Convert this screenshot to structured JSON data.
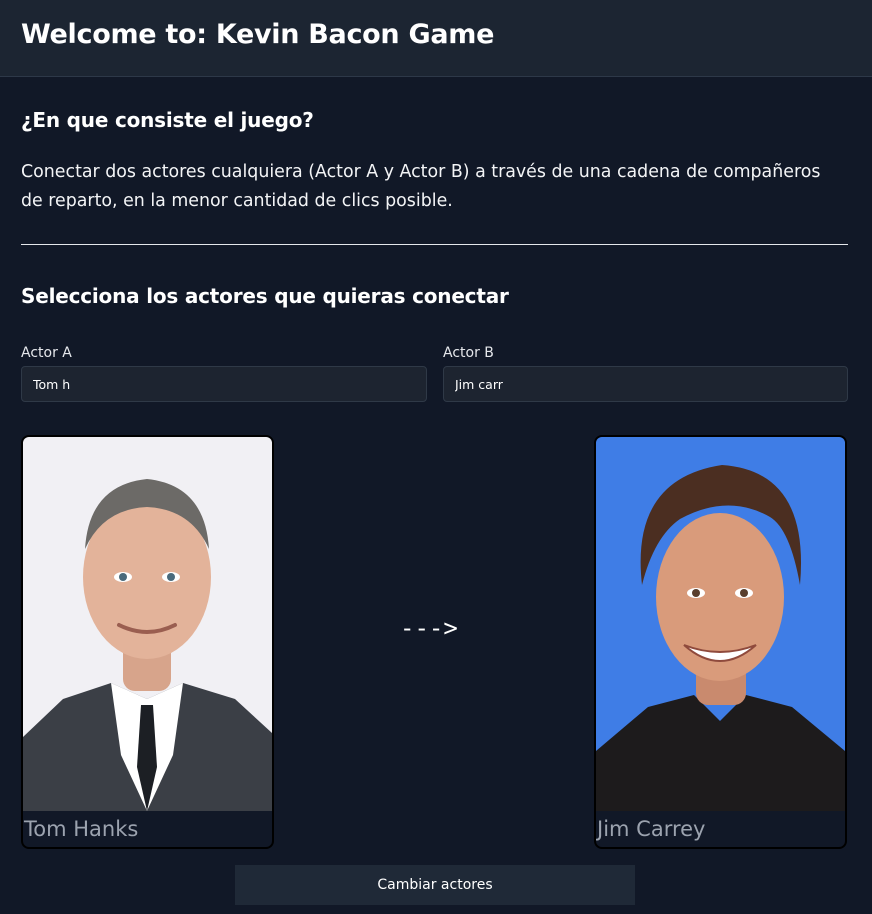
{
  "header": {
    "title": "Welcome to: Kevin Bacon Game"
  },
  "about": {
    "heading": "¿En que consiste el juego?",
    "description": "Conectar dos actores cualquiera (Actor A y Actor B) a través de una cadena de compañeros de reparto, en la menor cantidad de clics posible."
  },
  "selection": {
    "heading": "Selecciona los actores que quieras conectar",
    "actor_a": {
      "label": "Actor A",
      "value": "Tom h"
    },
    "actor_b": {
      "label": "Actor B",
      "value": "Jim carr"
    }
  },
  "cards": {
    "actor_a": {
      "name": "Tom Hanks",
      "photo_icon": "actor-photo",
      "background": "#f1f0f4"
    },
    "actor_b": {
      "name": "Jim Carrey",
      "photo_icon": "actor-photo",
      "background": "#3f7de6"
    }
  },
  "connector": {
    "arrow": "--->"
  },
  "actions": {
    "change_label": "Cambiar actores"
  }
}
